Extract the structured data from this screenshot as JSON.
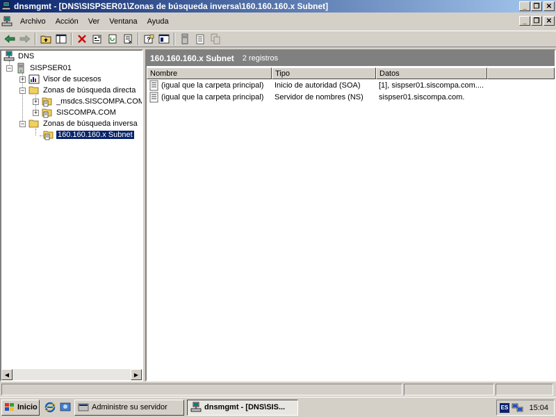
{
  "window": {
    "title": "dnsmgmt - [DNS\\SISPSER01\\Zonas de búsqueda inversa\\160.160.160.x Subnet]"
  },
  "menu": {
    "items": [
      {
        "label": "Archivo"
      },
      {
        "label": "Acción"
      },
      {
        "label": "Ver"
      },
      {
        "label": "Ventana"
      },
      {
        "label": "Ayuda"
      }
    ]
  },
  "tree": {
    "root": "DNS",
    "server": "SISPSER01",
    "event_viewer": "Visor de sucesos",
    "forward_zones": "Zonas de búsqueda directa",
    "zone_msdcs": "_msdcs.SISCOMPA.COM",
    "zone_siscompa": "SISCOMPA.COM",
    "reverse_zones": "Zonas de búsqueda inversa",
    "reverse_subnet": "160.160.160.x Subnet"
  },
  "details": {
    "title": "160.160.160.x Subnet",
    "count": "2 registros",
    "columns": [
      "Nombre",
      "Tipo",
      "Datos"
    ],
    "rows": [
      {
        "name": "(igual que la carpeta principal)",
        "type": "Inicio de autoridad (SOA)",
        "data": "[1], sispser01.siscompa.com...."
      },
      {
        "name": "(igual que la carpeta principal)",
        "type": "Servidor de nombres (NS)",
        "data": "sispser01.siscompa.com."
      }
    ]
  },
  "taskbar": {
    "start": "Inicio",
    "task1": "Administre su servidor",
    "task2": "dnsmgmt - [DNS\\SIS...",
    "lang": "ES",
    "clock": "15:04"
  }
}
